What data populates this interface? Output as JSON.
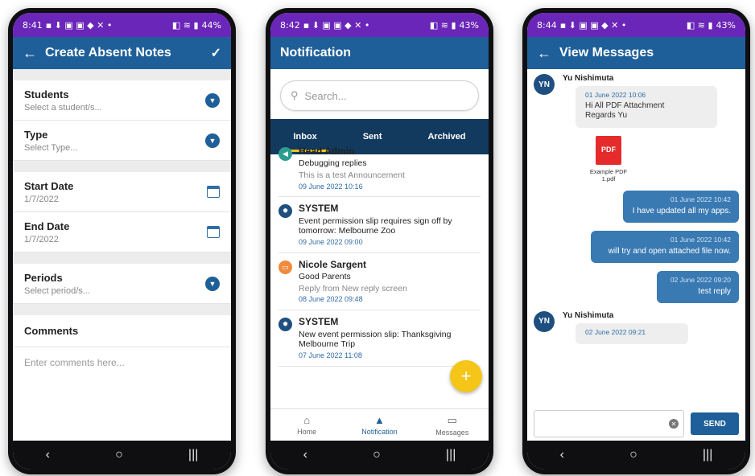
{
  "phone1": {
    "status": {
      "time": "8:41",
      "battery": "44%"
    },
    "appbar": {
      "back": "←",
      "title": "Create Absent Notes",
      "check": "✓"
    },
    "students": {
      "label": "Students",
      "placeholder": "Select a student/s..."
    },
    "type": {
      "label": "Type",
      "placeholder": "Select Type..."
    },
    "start_date": {
      "label": "Start Date",
      "value": "1/7/2022"
    },
    "end_date": {
      "label": "End Date",
      "value": "1/7/2022"
    },
    "periods": {
      "label": "Periods",
      "placeholder": "Select period/s..."
    },
    "comments": {
      "label": "Comments",
      "placeholder": "Enter comments here..."
    }
  },
  "phone2": {
    "status": {
      "time": "8:42",
      "battery": "43%"
    },
    "appbar": {
      "title": "Notification"
    },
    "search": {
      "placeholder": "Search..."
    },
    "tabs": [
      {
        "label": "Inbox"
      },
      {
        "label": "Sent"
      },
      {
        "label": "Archived"
      }
    ],
    "notifications": [
      {
        "title": "Head Admin",
        "line1": "Debugging replies",
        "sub": "This is a test Announcement",
        "date": "09 June 2022 10:16",
        "icon": "megaphone-icon",
        "color": "#2a9d8f"
      },
      {
        "title": "SYSTEM",
        "line1": "Event permission slip requires sign off by tomorrow: Melbourne Zoo",
        "sub": "",
        "date": "09 June 2022 09:00",
        "icon": "gear-icon",
        "color": "#1f4f80"
      },
      {
        "title": "Nicole Sargent",
        "line1": "Good Parents",
        "sub": "Reply from New reply screen",
        "date": "08 June 2022 09:48",
        "icon": "chat-icon",
        "color": "#f08a3c"
      },
      {
        "title": "SYSTEM",
        "line1": "New event permission slip: Thanksgiving Melbourne Trip",
        "sub": "",
        "date": "07 June 2022 11:08",
        "icon": "gear-icon",
        "color": "#1f4f80"
      }
    ],
    "fab": "+",
    "bottomnav": [
      {
        "label": "Home"
      },
      {
        "label": "Notification"
      },
      {
        "label": "Messages"
      }
    ]
  },
  "phone3": {
    "status": {
      "time": "8:44",
      "battery": "43%"
    },
    "appbar": {
      "back": "←",
      "title": "View Messages"
    },
    "msg1": {
      "avatar": "YN",
      "sender": "Yu Nishimuta",
      "date": "01 June 2022 10:06",
      "line1": "Hi All  PDF Attachment",
      "line2": "Regards  Yu"
    },
    "attachment": {
      "badge": "PDF",
      "name": "Example PDF 1.pdf"
    },
    "out1": {
      "date": "01 June 2022 10:42",
      "text": "I have updated all my apps."
    },
    "out2": {
      "date": "01 June 2022 10:42",
      "text": "will try and open attached file now."
    },
    "out3": {
      "date": "02 June 2022 09:20",
      "text": "test reply"
    },
    "msg2": {
      "avatar": "YN",
      "sender": "Yu Nishimuta",
      "date": "02 June 2022 09:21"
    },
    "send": "SEND"
  },
  "nav": {
    "back": "‹",
    "home": "○",
    "recents": "|||"
  }
}
